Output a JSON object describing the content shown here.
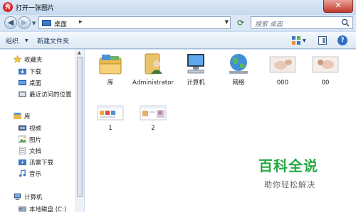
{
  "window": {
    "title": "打开一张图片",
    "app_icon_char": "秀",
    "close_symbol": "✕"
  },
  "address": {
    "location": "桌面",
    "search_placeholder": "搜索 桌面"
  },
  "toolbar": {
    "organize": "组织",
    "new_folder": "新建文件夹"
  },
  "nav": {
    "favorites": "收藏夹",
    "downloads": "下载",
    "desktop": "桌面",
    "recent": "最近访问的位置",
    "libraries": "库",
    "videos": "视频",
    "pictures": "图片",
    "documents": "文档",
    "thunder": "迅雷下载",
    "music": "音乐",
    "computer": "计算机",
    "local_disk": "本地磁盘 (C:)"
  },
  "files": [
    {
      "label": "库",
      "icon": "library-icon"
    },
    {
      "label": "Administrator",
      "icon": "user-folder-icon"
    },
    {
      "label": "计算机",
      "icon": "computer-icon"
    },
    {
      "label": "网络",
      "icon": "network-icon"
    },
    {
      "label": "000",
      "icon": "image-thumbnail"
    },
    {
      "label": "00",
      "icon": "image-thumbnail"
    },
    {
      "label": "1",
      "icon": "image-thumbnail"
    },
    {
      "label": "2",
      "icon": "image-thumbnail"
    }
  ],
  "watermark": {
    "main": "百科全说",
    "sub": "助你轻松解决"
  },
  "colors": {
    "accent": "#3c78c4",
    "watermark_green": "#27a844",
    "close_red": "#c4392b"
  }
}
